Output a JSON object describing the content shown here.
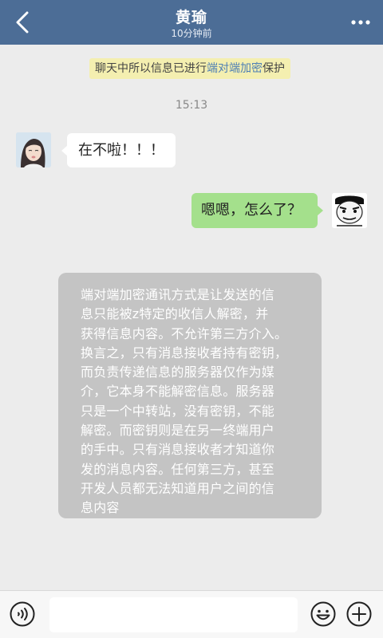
{
  "header": {
    "title": "黄瑜",
    "subtitle": "10分钟前"
  },
  "notice": {
    "prefix": "聊天中所以信息已进行",
    "highlight": "端对端加密",
    "suffix": "保护"
  },
  "timestamp": "15:13",
  "messages": [
    {
      "side": "left",
      "text": "在不啦！！！"
    },
    {
      "side": "right",
      "text": "嗯嗯，怎么了？"
    }
  ],
  "info_card": {
    "lines": [
      "端对端加密通讯方式是让发送的信",
      "息只能被z特定的收信人解密，并",
      "获得信息内容。不允许第三方介入。",
      "换言之，只有消息接收者持有密钥，",
      "而负责传递信息的服务器仅作为媒",
      "介，它本身不能解密信息。服务器",
      "只是一个中转站，没有密钥，不能",
      "解密。而密钥则是在另一终端用户",
      "的手中。只有消息接收者才知道你",
      "发的消息内容。任何第三方，甚至",
      "开发人员都无法知道用户之间的信",
      "息内容"
    ]
  },
  "input": {
    "value": "",
    "placeholder": ""
  },
  "colors": {
    "header_bg": "#4c6d96",
    "page_bg": "#ececec",
    "notice_bg": "#f4efb0",
    "notice_highlight": "#4e7fb5",
    "bubble_right": "#a4e08c",
    "bubble_left": "#ffffff",
    "info_card_bg": "#c4c4c4"
  },
  "icons": {
    "back": "chevron-left-icon",
    "more": "more-dots-icon",
    "voice": "voice-icon",
    "emoji": "emoji-icon",
    "plus": "plus-icon"
  }
}
